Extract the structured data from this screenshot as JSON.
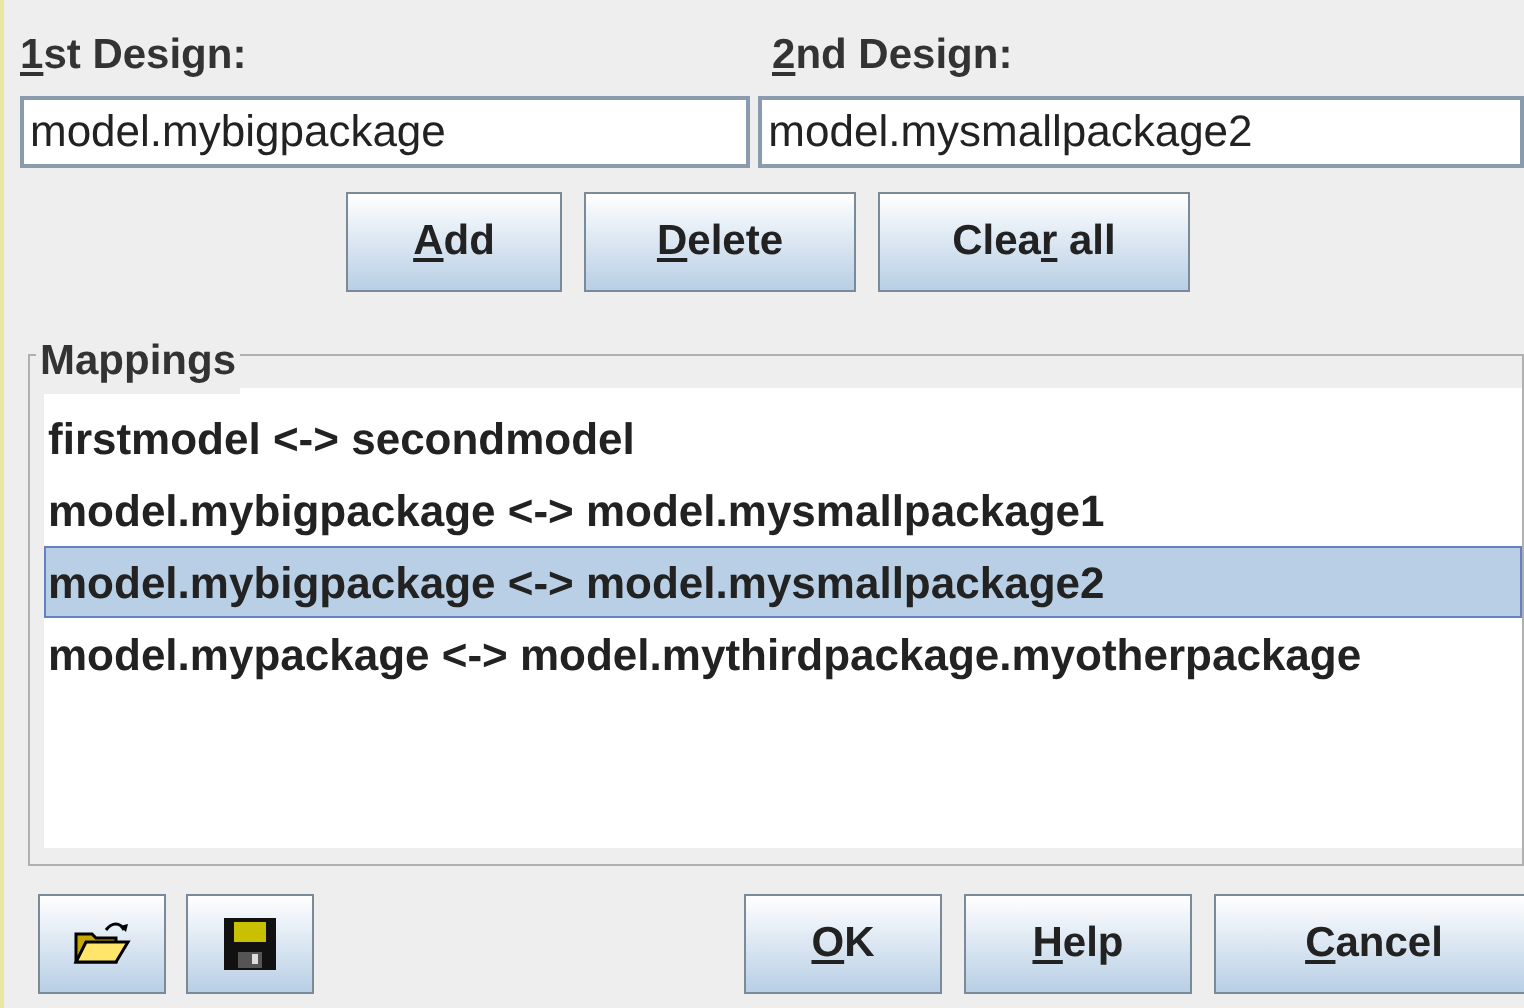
{
  "design1": {
    "label": {
      "key": "1",
      "after": "st Design:"
    },
    "value": "model.mybigpackage"
  },
  "design2": {
    "label": {
      "key": "2",
      "after": "nd Design:"
    },
    "value": "model.mysmallpackage2"
  },
  "actions": [
    {
      "key": "A",
      "after": "dd"
    },
    {
      "key": "D",
      "after": "elete"
    },
    {
      "before": "Clea",
      "key": "r",
      "after": " all"
    }
  ],
  "mappings": {
    "title": "Mappings",
    "items": [
      {
        "text": "firstmodel <-> secondmodel",
        "selected": false
      },
      {
        "text": "model.mybigpackage <-> model.mysmallpackage1",
        "selected": false
      },
      {
        "text": "model.mybigpackage <-> model.mysmallpackage2",
        "selected": true
      },
      {
        "text": "model.mypackage <-> model.mythirdpackage.myotherpackage",
        "selected": false
      }
    ]
  },
  "dialog_buttons": [
    {
      "key": "O",
      "after": "K"
    },
    {
      "key": "H",
      "after": "elp"
    },
    {
      "key": "C",
      "after": "ancel"
    }
  ]
}
